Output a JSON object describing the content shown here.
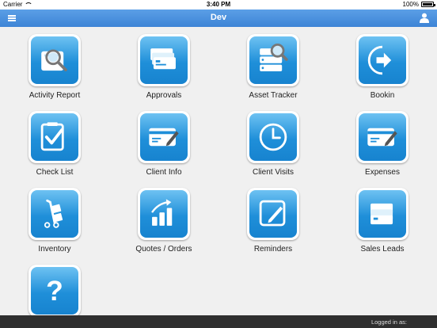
{
  "status_bar": {
    "carrier": "Carrier",
    "time": "3:40 PM",
    "battery": "100%",
    "battery_level": 1.0
  },
  "nav": {
    "title": "Dev",
    "menu_icon": "hamburger-menu-icon",
    "user_icon": "user-profile-icon"
  },
  "colors": {
    "nav": "#4a90e2",
    "icon_gradient_top": "#6ec2f2",
    "icon_gradient_bottom": "#1783cf",
    "bottom_bar": "#2f2f2f"
  },
  "tiles": [
    {
      "label": "Activity Report",
      "icon": "activity-report-icon"
    },
    {
      "label": "Approvals",
      "icon": "approvals-icon"
    },
    {
      "label": "Asset Tracker",
      "icon": "asset-tracker-icon"
    },
    {
      "label": "Bookin",
      "icon": "bookin-icon"
    },
    {
      "label": "Check List",
      "icon": "check-list-icon"
    },
    {
      "label": "Client Info",
      "icon": "client-info-icon"
    },
    {
      "label": "Client Visits",
      "icon": "client-visits-icon"
    },
    {
      "label": "Expenses",
      "icon": "expenses-icon"
    },
    {
      "label": "Inventory",
      "icon": "inventory-icon"
    },
    {
      "label": "Quotes / Orders",
      "icon": "quotes-orders-icon"
    },
    {
      "label": "Reminders",
      "icon": "reminders-icon"
    },
    {
      "label": "Sales Leads",
      "icon": "sales-leads-icon"
    },
    {
      "label": "",
      "icon": "help-icon"
    }
  ],
  "bottom_bar": {
    "logged_in": "Logged in as:"
  }
}
